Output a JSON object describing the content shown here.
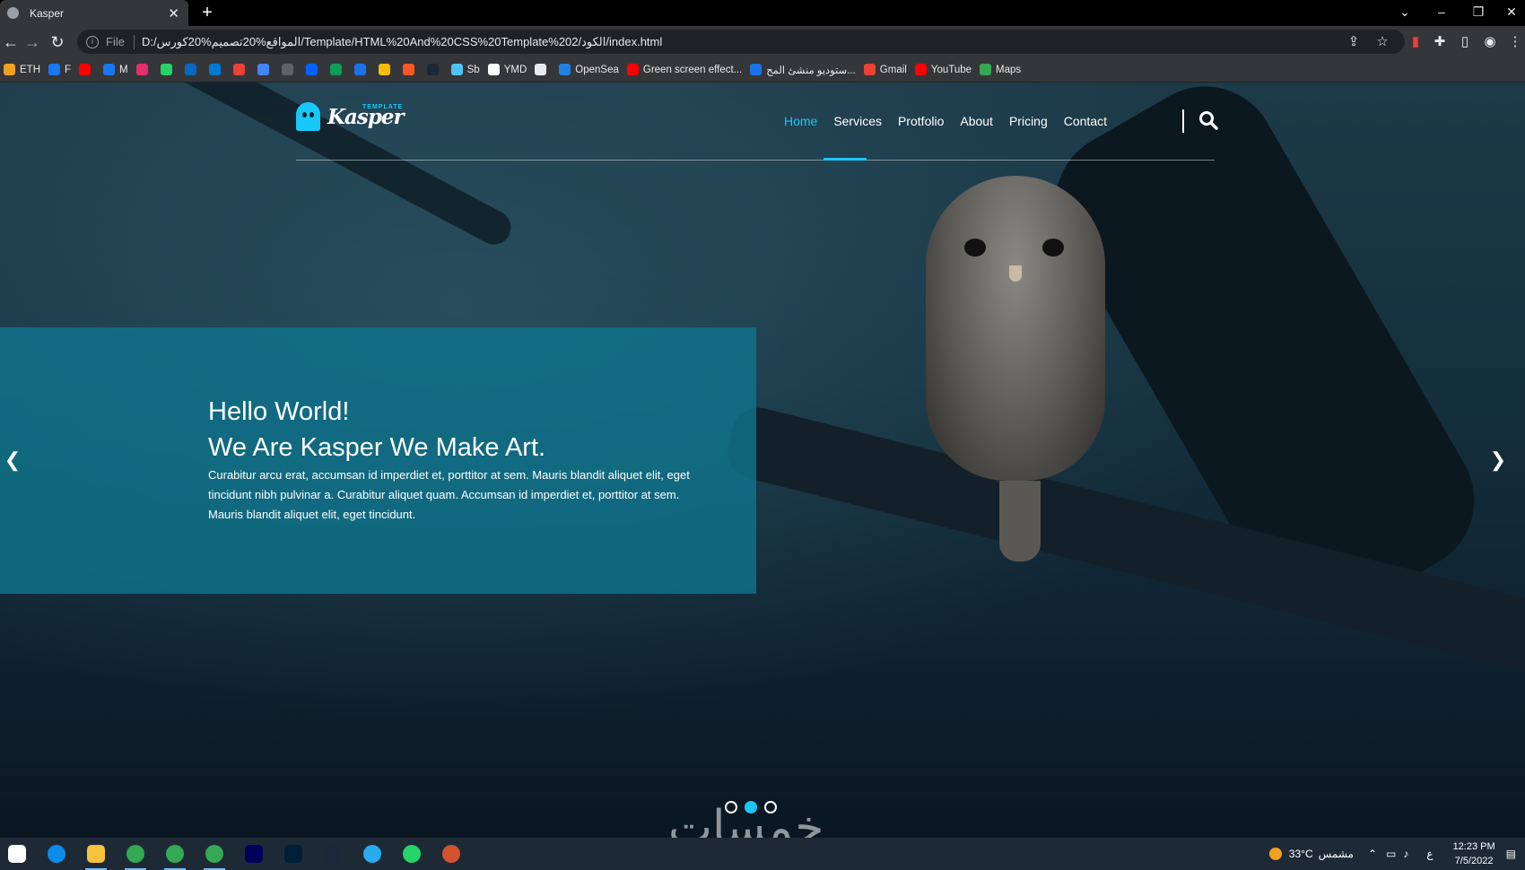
{
  "browser": {
    "tab_title": "Kasper",
    "file_label": "File",
    "url": "D:/المواقع%20تصميم%20كورس/Template/HTML%20And%20CSS%20Template%202/الكود/index.html",
    "bookmarks": [
      {
        "label": "ETH",
        "color": "#f2a01f"
      },
      {
        "label": "F",
        "color": "#1877f2"
      },
      {
        "label": "",
        "color": "#ff0000"
      },
      {
        "label": "M",
        "color": "#1877f2"
      },
      {
        "label": "",
        "color": "#e1306c"
      },
      {
        "label": "",
        "color": "#25d366"
      },
      {
        "label": "",
        "color": "#0a66c2"
      },
      {
        "label": "",
        "color": "#0078d4"
      },
      {
        "label": "",
        "color": "#ea4335"
      },
      {
        "label": "",
        "color": "#4285f4"
      },
      {
        "label": "",
        "color": "#5f6368"
      },
      {
        "label": "",
        "color": "#0061ff"
      },
      {
        "label": "",
        "color": "#0f9d58"
      },
      {
        "label": "",
        "color": "#1a73e8"
      },
      {
        "label": "",
        "color": "#fbbc04"
      },
      {
        "label": "",
        "color": "#ff5722"
      },
      {
        "label": "",
        "color": "#1b2838"
      },
      {
        "label": "Sb",
        "color": "#4fc3f7"
      },
      {
        "label": "YMD",
        "color": "#ffffff"
      },
      {
        "label": "",
        "color": "#e8eaed"
      },
      {
        "label": "OpenSea",
        "color": "#2081e2"
      },
      {
        "label": "Green screen effect...",
        "color": "#ff0000"
      },
      {
        "label": "ستوديو منشئ المح...",
        "color": "#1a73e8"
      },
      {
        "label": "Gmail",
        "color": "#ea4335"
      },
      {
        "label": "YouTube",
        "color": "#ff0000"
      },
      {
        "label": "Maps",
        "color": "#34a853"
      }
    ]
  },
  "site": {
    "logo_name": "Kasper",
    "logo_tag": "TEMPLATE",
    "nav": [
      "Home",
      "Services",
      "Protfolio",
      "About",
      "Pricing",
      "Contact"
    ],
    "active_nav": "Home",
    "accent_color": "#19c8fa",
    "hero": {
      "line1": "Hello World!",
      "line2": "We Are Kasper We Make Art.",
      "text": "Curabitur arcu erat, accumsan id imperdiet et, porttitor at sem. Mauris blandit aliquet elit, eget tincidunt nibh pulvinar a. Curabitur aliquet quam. Accumsan id imperdiet et, porttitor at sem. Mauris blandit aliquet elit, eget tincidunt."
    },
    "slider_dots": 3,
    "active_dot": 2,
    "watermark": "خمسات"
  },
  "taskbar": {
    "apps": [
      {
        "name": "start",
        "color": "#ffffff"
      },
      {
        "name": "edge",
        "color": "#0c8ce9"
      },
      {
        "name": "file-explorer",
        "color": "#f8c33c"
      },
      {
        "name": "chrome",
        "color": "#34a853"
      },
      {
        "name": "chrome",
        "color": "#34a853"
      },
      {
        "name": "chrome",
        "color": "#34a853"
      },
      {
        "name": "premiere",
        "color": "#00005b"
      },
      {
        "name": "photoshop",
        "color": "#001e36"
      },
      {
        "name": "steam",
        "color": "#1b2838"
      },
      {
        "name": "telegram",
        "color": "#2aabee"
      },
      {
        "name": "whatsapp",
        "color": "#25d366"
      },
      {
        "name": "powerpoint-like",
        "color": "#d35230"
      }
    ],
    "weather": "33°C",
    "weather_desc": "مشمس",
    "lang": "ع",
    "time": "12:23 PM",
    "date": "7/5/2022"
  }
}
